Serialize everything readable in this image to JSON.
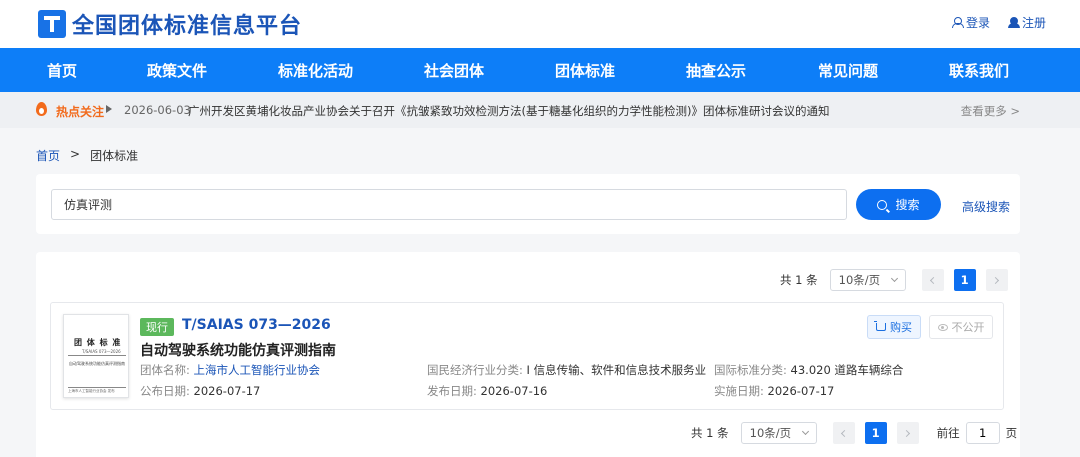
{
  "header": {
    "logo_text": "全国团体标准信息平台",
    "login_label": "登录",
    "register_label": "注册"
  },
  "nav": {
    "items": [
      "首页",
      "政策文件",
      "标准化活动",
      "社会团体",
      "团体标准",
      "抽查公示",
      "常见问题",
      "联系我们"
    ]
  },
  "hotbar": {
    "label": "热点关注",
    "date": "2026-06-03",
    "title": "广州开发区黄埔化妆品产业协会关于召开《抗皱紧致功效检测方法(基于糖基化组织的力学性能检测)》团体标准研讨会议的通知",
    "more_label": "查看更多 >"
  },
  "breadcrumb": {
    "home": "首页",
    "separator": ">",
    "current": "团体标准"
  },
  "search": {
    "value": "仿真评测",
    "button_label": "搜索",
    "advanced_label": "高级搜索"
  },
  "pagination": {
    "total": "共 1 条",
    "page_size": "10条/页",
    "current_page": "1",
    "goto_label": "前往",
    "goto_value": "1",
    "page_suffix": "页"
  },
  "result": {
    "status": "现行",
    "code": "T/SAIAS 073—2026",
    "title": "自动驾驶系统功能仿真评测指南",
    "org_label": "团体名称: ",
    "org_value": "上海市人工智能行业协会",
    "industry_label": "国民经济行业分类: ",
    "industry_value": "I 信息传输、软件和信息技术服务业",
    "ics_label": "国际标准分类: ",
    "ics_value": "43.020 道路车辆综合",
    "publish_label": "公布日期: ",
    "publish_value": "2026-07-17",
    "release_label": "发布日期: ",
    "release_value": "2026-07-16",
    "implement_label": "实施日期: ",
    "implement_value": "2026-07-17",
    "buy_label": "购买",
    "private_label": "不公开",
    "thumb": {
      "heading": "团 体 标 准",
      "code": "T/SAIAS 073—2026",
      "name": "自动驾驶系统功能仿真评测指南",
      "footer": "上海市人工智能行业协会 发布"
    }
  }
}
